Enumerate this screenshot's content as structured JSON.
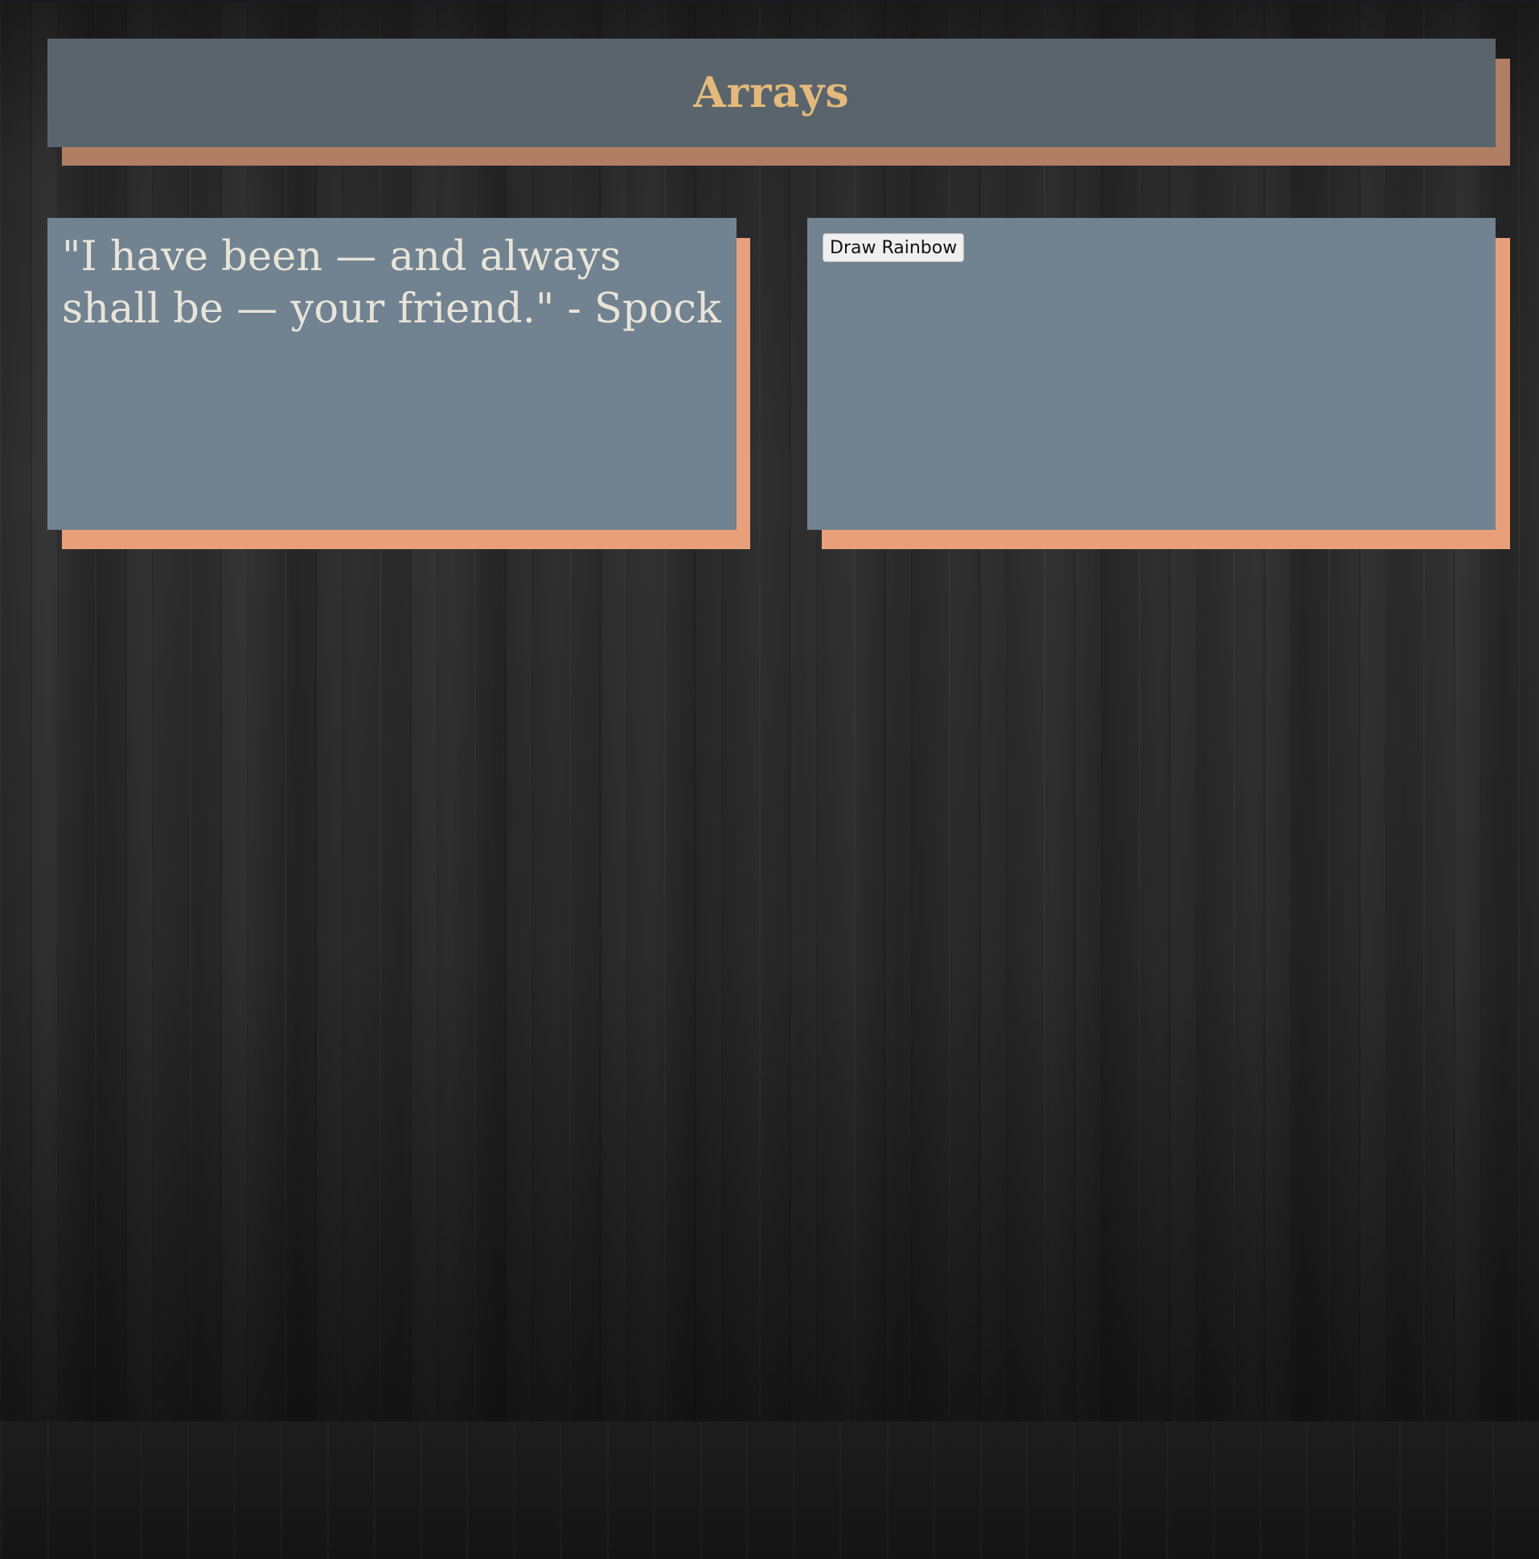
{
  "header": {
    "title": "Arrays"
  },
  "quote_card": {
    "text": "\"I have been — and always shall be — your friend.\" - Spock"
  },
  "rainbow_card": {
    "button_label": "Draw Rainbow"
  },
  "colors": {
    "header_bg": "#59646d",
    "header_title": "#e4b979",
    "card_bg": "#718290",
    "card_shadow": "#e8a07a",
    "header_shadow": "#b07e62",
    "quote_text": "#e8e4d8"
  }
}
